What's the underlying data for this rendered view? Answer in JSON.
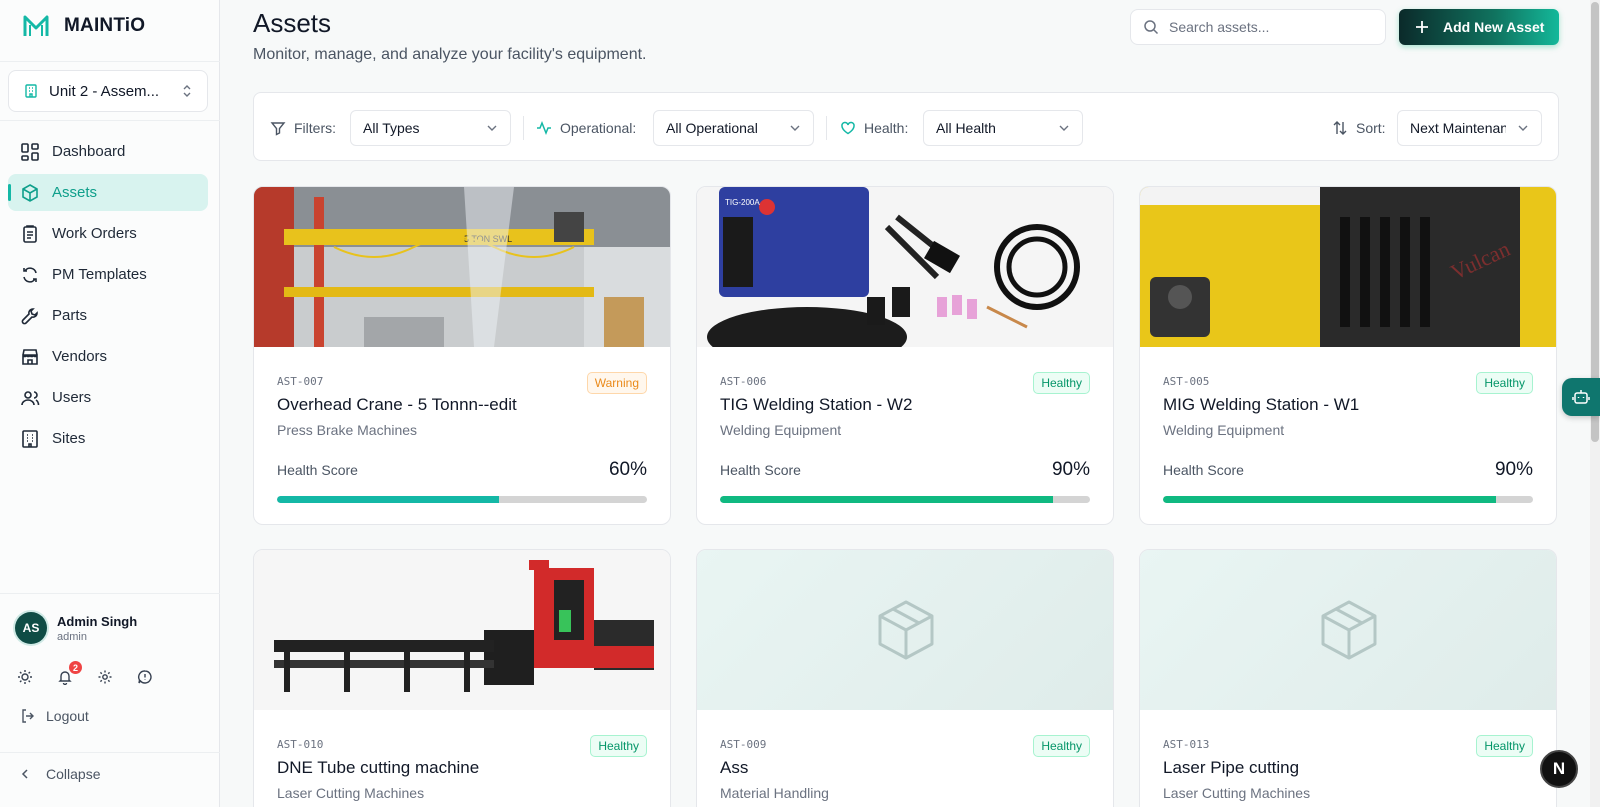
{
  "brand": {
    "name": "MAINTiO"
  },
  "site_selector": {
    "value": "Unit 2 - Assem..."
  },
  "nav": [
    {
      "label": "Dashboard",
      "icon": "dashboard-icon"
    },
    {
      "label": "Assets",
      "icon": "box-icon",
      "active": true
    },
    {
      "label": "Work Orders",
      "icon": "clipboard-icon"
    },
    {
      "label": "PM Templates",
      "icon": "refresh-icon"
    },
    {
      "label": "Parts",
      "icon": "wrench-icon"
    },
    {
      "label": "Vendors",
      "icon": "store-icon"
    },
    {
      "label": "Users",
      "icon": "users-icon"
    },
    {
      "label": "Sites",
      "icon": "building-icon"
    }
  ],
  "user": {
    "initials": "AS",
    "name": "Admin Singh",
    "role": "admin",
    "notification_count": "2"
  },
  "logout_label": "Logout",
  "collapse_label": "Collapse",
  "header": {
    "title": "Assets",
    "subtitle": "Monitor, manage, and analyze your facility's equipment.",
    "search_placeholder": "Search assets...",
    "add_button": "Add New Asset"
  },
  "filters": {
    "label": "Filters:",
    "type_value": "All Types",
    "operational_label": "Operational:",
    "operational_value": "All Operational",
    "health_label": "Health:",
    "health_value": "All Health",
    "sort_label": "Sort:",
    "sort_value": "Next Maintenance"
  },
  "health_score_label": "Health Score",
  "colors": {
    "accent": "#14b8a6",
    "healthy": "#10b981",
    "warning": "#f59e0b",
    "bar_bg": "#d4d4d4"
  },
  "assets": [
    {
      "code": "AST-007",
      "name": "Overhead Crane - 5 Tonnn--edit",
      "type": "Press Brake Machines",
      "status": "Warning",
      "score": "60%",
      "score_value": 60,
      "image": "crane"
    },
    {
      "code": "AST-006",
      "name": "TIG Welding Station - W2",
      "type": "Welding Equipment",
      "status": "Healthy",
      "score": "90%",
      "score_value": 90,
      "image": "tig-welder"
    },
    {
      "code": "AST-005",
      "name": "MIG Welding Station - W1",
      "type": "Welding Equipment",
      "status": "Healthy",
      "score": "90%",
      "score_value": 90,
      "image": "mig-welder"
    },
    {
      "code": "AST-010",
      "name": "DNE Tube cutting machine",
      "type": "Laser Cutting Machines",
      "status": "Healthy",
      "image": "laser-cutter"
    },
    {
      "code": "AST-009",
      "name": "Ass",
      "type": "Material Handling",
      "status": "Healthy",
      "image": "placeholder"
    },
    {
      "code": "AST-013",
      "name": "Laser Pipe cutting",
      "type": "Laser Cutting Machines",
      "status": "Healthy",
      "image": "placeholder"
    }
  ],
  "floating": {
    "next_badge": "N"
  }
}
